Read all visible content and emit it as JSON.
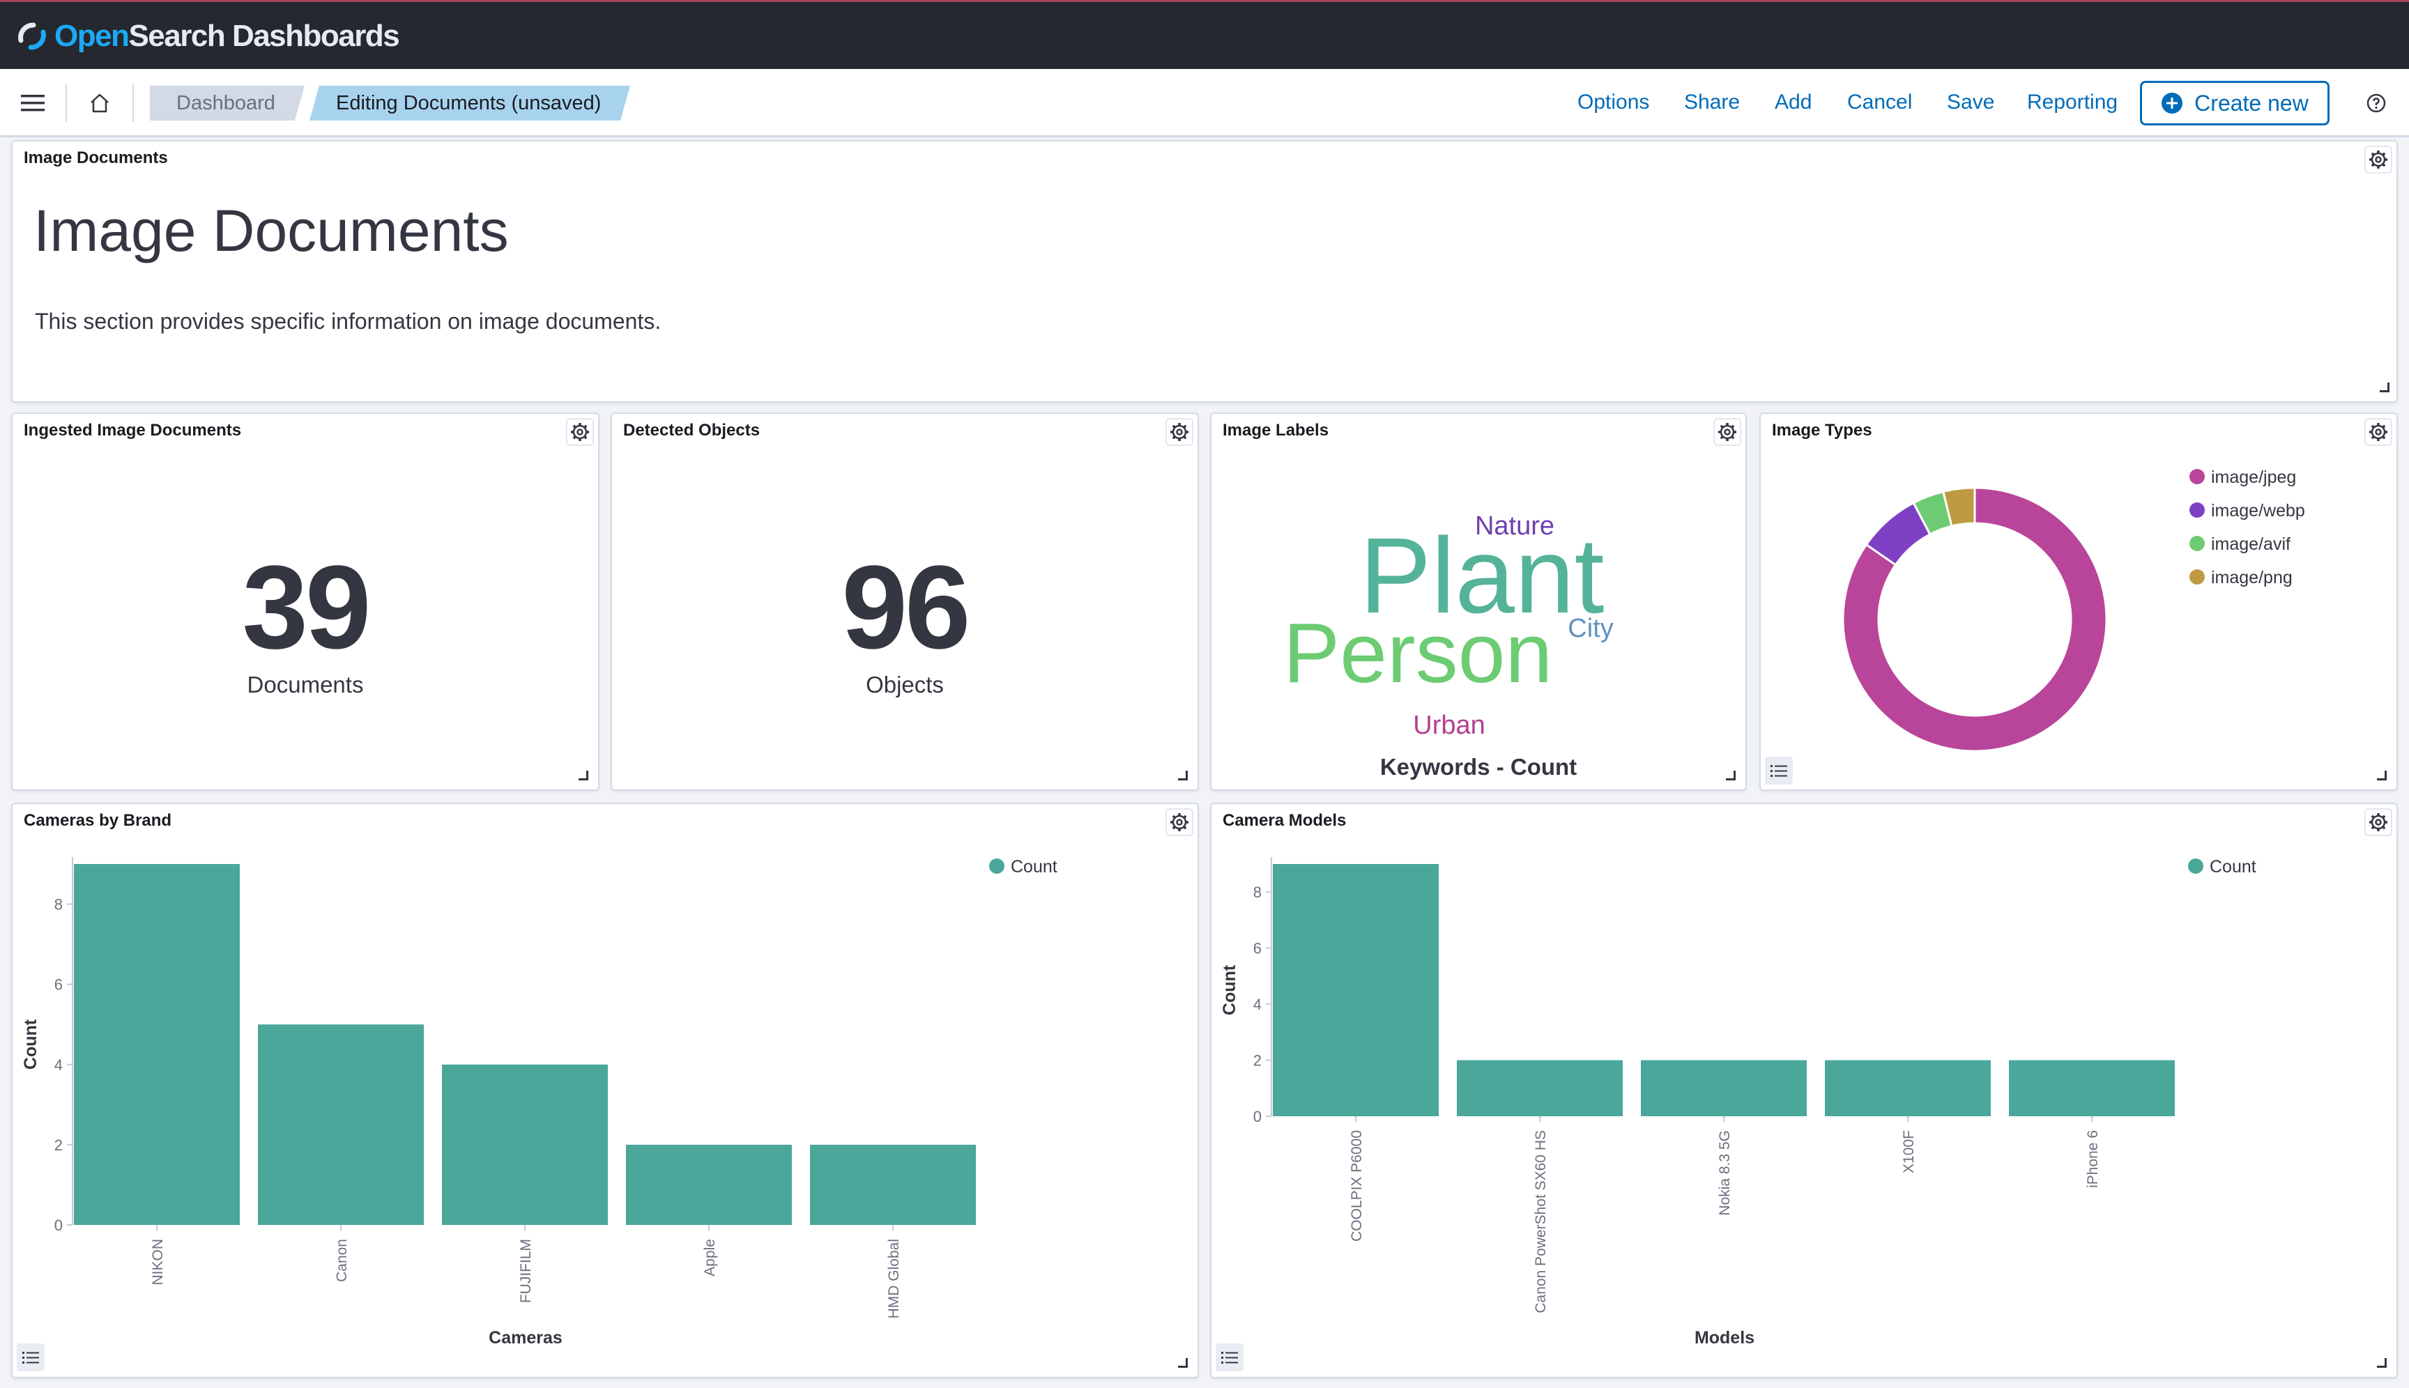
{
  "app": {
    "logo_open": "Open",
    "logo_rest": "Search Dashboards"
  },
  "nav": {
    "breadcrumbs": [
      "Dashboard",
      "Editing Documents (unsaved)"
    ],
    "menu": [
      "Options",
      "Share",
      "Add",
      "Cancel",
      "Save",
      "Reporting"
    ],
    "create_label": "Create new"
  },
  "panels": {
    "markdown": {
      "title": "Image Documents",
      "heading": "Image Documents",
      "text": "This section provides specific information on image documents."
    },
    "ingested": {
      "title": "Ingested Image Documents",
      "value": "39",
      "label": "Documents"
    },
    "detected": {
      "title": "Detected Objects",
      "value": "96",
      "label": "Objects"
    },
    "labels": {
      "title": "Image Labels",
      "caption": "Keywords - Count",
      "words": [
        {
          "text": "Plant",
          "color": "#54b399"
        },
        {
          "text": "Person",
          "color": "#6dcc73"
        },
        {
          "text": "Nature",
          "color": "#6f3fae"
        },
        {
          "text": "City",
          "color": "#6092c0"
        },
        {
          "text": "Urban",
          "color": "#b2418f"
        }
      ]
    },
    "types": {
      "title": "Image Types"
    },
    "brands": {
      "title": "Cameras by Brand"
    },
    "models": {
      "title": "Camera Models"
    }
  },
  "chart_data": [
    {
      "type": "pie",
      "donut": true,
      "labels": [
        "image/jpeg",
        "image/webp",
        "image/avif",
        "image/png"
      ],
      "values": [
        33,
        3,
        1.5,
        1.5
      ],
      "colors": [
        "#b9459b",
        "#8040c4",
        "#6dcc73",
        "#bf9a42"
      ],
      "legend": "top-right"
    },
    {
      "type": "bar",
      "categories": [
        "NIKON",
        "Canon",
        "FUJIFILM",
        "Apple",
        "HMD Global"
      ],
      "values": [
        9,
        5,
        4,
        2,
        2
      ],
      "series": [
        {
          "name": "Count",
          "values": [
            9,
            5,
            4,
            2,
            2
          ]
        }
      ],
      "xlabel": "Cameras",
      "ylabel": "Count",
      "yticks": [
        0,
        2,
        4,
        6,
        8
      ],
      "ylim": [
        0,
        9
      ],
      "color": "#4aa79a",
      "legend": "top-right"
    },
    {
      "type": "bar",
      "categories": [
        "COOLPIX P6000",
        "Canon PowerShot SX60 HS",
        "Nokia 8.3 5G",
        "X100F",
        "iPhone 6"
      ],
      "values": [
        9,
        2,
        2,
        2,
        2
      ],
      "series": [
        {
          "name": "Count",
          "values": [
            9,
            2,
            2,
            2,
            2
          ]
        }
      ],
      "xlabel": "Models",
      "ylabel": "Count",
      "yticks": [
        0,
        2,
        4,
        6,
        8
      ],
      "ylim": [
        0,
        9
      ],
      "color": "#4aa79a",
      "legend": "top-right"
    }
  ]
}
